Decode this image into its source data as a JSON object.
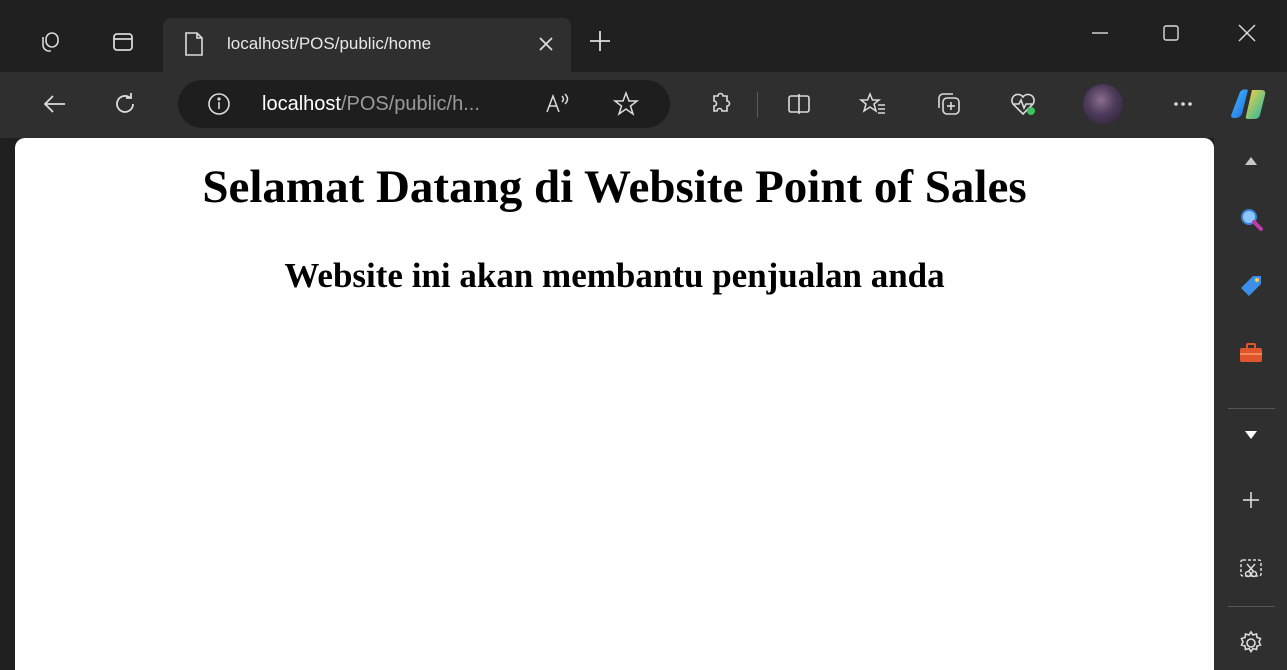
{
  "browser": {
    "tab": {
      "title": "localhost/POS/public/home"
    },
    "address": {
      "host": "localhost",
      "path": "/POS/public/h..."
    }
  },
  "page": {
    "heading": "Selamat Datang di Website Point of Sales",
    "subheading": "Website ini akan membantu penjualan anda"
  },
  "toolbar_icons": [
    "back-icon",
    "refresh-icon",
    "info-icon",
    "read-aloud-icon",
    "favorite-star-icon",
    "extensions-icon",
    "split-screen-icon",
    "favorites-icon",
    "collections-icon",
    "browser-essentials-icon",
    "profile-avatar",
    "more-icon",
    "copilot-icon"
  ],
  "sidebar_icons": [
    "scroll-up-icon",
    "search-icon",
    "shopping-tag-icon",
    "tools-icon",
    "scroll-down-icon",
    "add-icon",
    "screenshot-icon",
    "settings-icon"
  ],
  "colors": {
    "chrome": "#202020",
    "toolbar": "#2f2f2f",
    "content": "#ffffff"
  }
}
